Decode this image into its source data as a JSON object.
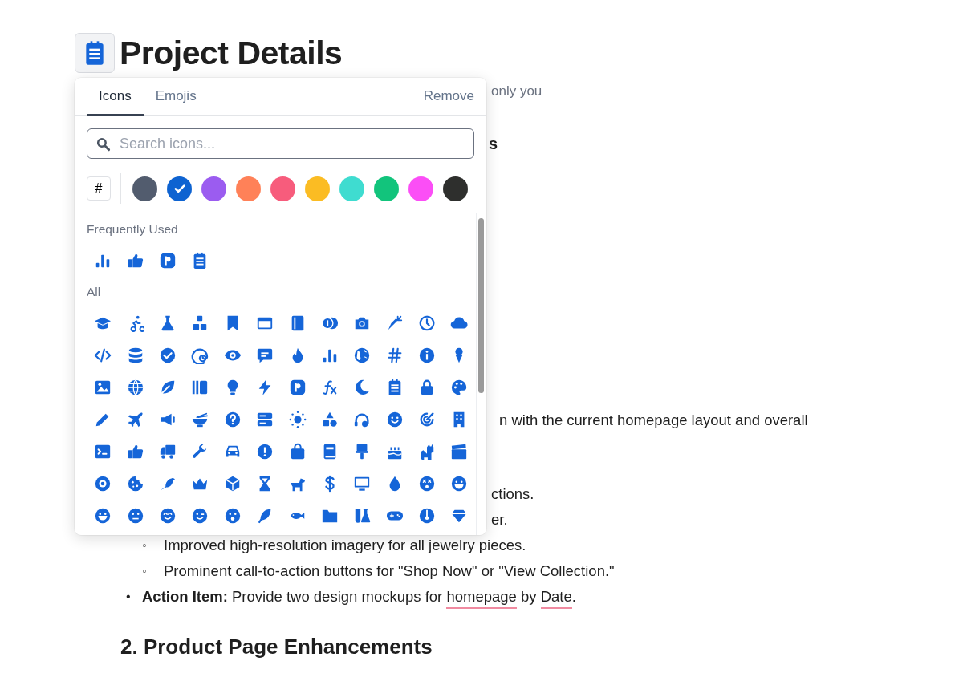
{
  "page": {
    "title": "Project Details",
    "fragments": [
      {
        "kind": "note",
        "text": "only you"
      },
      {
        "kind": "heading",
        "text": "s"
      },
      {
        "kind": "line",
        "text": "n with the current homepage layout and overall"
      },
      {
        "kind": "line",
        "text": "ctions."
      },
      {
        "kind": "line",
        "text": "er."
      }
    ],
    "sub_bullets": [
      {
        "marker": "◦",
        "text": "Improved high-resolution imagery for all jewelry pieces."
      },
      {
        "marker": "◦",
        "text": "Prominent call-to-action buttons for \"Shop Now\" or \"View Collection.\""
      }
    ],
    "action_item": {
      "marker": "•",
      "label": "Action Item:",
      "segments": [
        {
          "text": " Provide two design mockups for ",
          "flagged": false
        },
        {
          "text": "homepage",
          "flagged": true
        },
        {
          "text": " by ",
          "flagged": false
        },
        {
          "text": "Date",
          "flagged": true
        },
        {
          "text": ".",
          "flagged": false
        }
      ]
    },
    "heading": "2. Product Page Enhancements"
  },
  "picker": {
    "tabs": [
      {
        "label": "Icons",
        "selected": true
      },
      {
        "label": "Emojis",
        "selected": false
      }
    ],
    "remove": "Remove",
    "search": {
      "placeholder": "Search icons..."
    },
    "custom_color": "#",
    "colors": [
      {
        "color": "#525c6e",
        "selected": false
      },
      {
        "color": "#0e63d1",
        "selected": true
      },
      {
        "color": "#9b5cf0",
        "selected": false
      },
      {
        "color": "#ff8158",
        "selected": false
      },
      {
        "color": "#f75c7c",
        "selected": false
      },
      {
        "color": "#fbbc23",
        "selected": false
      },
      {
        "color": "#3fdcd0",
        "selected": false
      },
      {
        "color": "#12c47c",
        "selected": false
      },
      {
        "color": "#fb4ef6",
        "selected": false
      },
      {
        "color": "#2e2f2d",
        "selected": false
      }
    ],
    "sections": [
      {
        "kind": "frequent",
        "title": "Frequently Used"
      },
      {
        "kind": "all",
        "title": "All"
      }
    ]
  }
}
